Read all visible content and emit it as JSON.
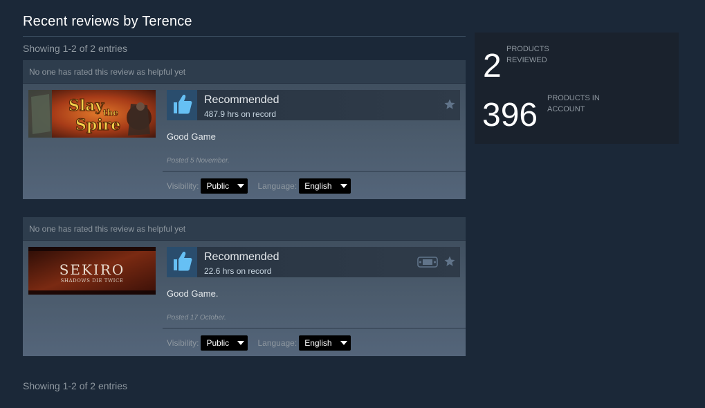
{
  "page": {
    "title": "Recent reviews by Terence",
    "entries_top": "Showing 1-2 of 2 entries",
    "entries_bottom": "Showing 1-2 of 2 entries"
  },
  "reviews": [
    {
      "helpful": "No one has rated this review as helpful yet",
      "game": "Slay the Spire",
      "recommendation": "Recommended",
      "hours": "487.9 hrs on record",
      "text": "Good Game",
      "posted": "Posted 5 November.",
      "visibility_label": "Visibility:",
      "visibility_value": "Public",
      "language_label": "Language:",
      "language_value": "English"
    },
    {
      "helpful": "No one has rated this review as helpful yet",
      "game": "Sekiro: Shadows Die Twice",
      "capsule_title": "SEKIRO",
      "capsule_subtitle": "SHADOWS DIE TWICE",
      "recommendation": "Recommended",
      "hours": "22.6 hrs on record",
      "text": "Good Game.",
      "posted": "Posted 17 October.",
      "visibility_label": "Visibility:",
      "visibility_value": "Public",
      "language_label": "Language:",
      "language_value": "English"
    }
  ],
  "stats": {
    "reviewed_count": "2",
    "reviewed_label": "Products reviewed",
    "account_count": "396",
    "account_label": "Products in account"
  },
  "icons": {
    "thumbs_up": "thumbs-up-icon",
    "star": "star-icon",
    "steam_deck": "steam-deck-icon"
  },
  "colors": {
    "background": "#1b2838",
    "thumb_blue": "#66c0f4",
    "thumb_box": "#2a4d6d"
  }
}
